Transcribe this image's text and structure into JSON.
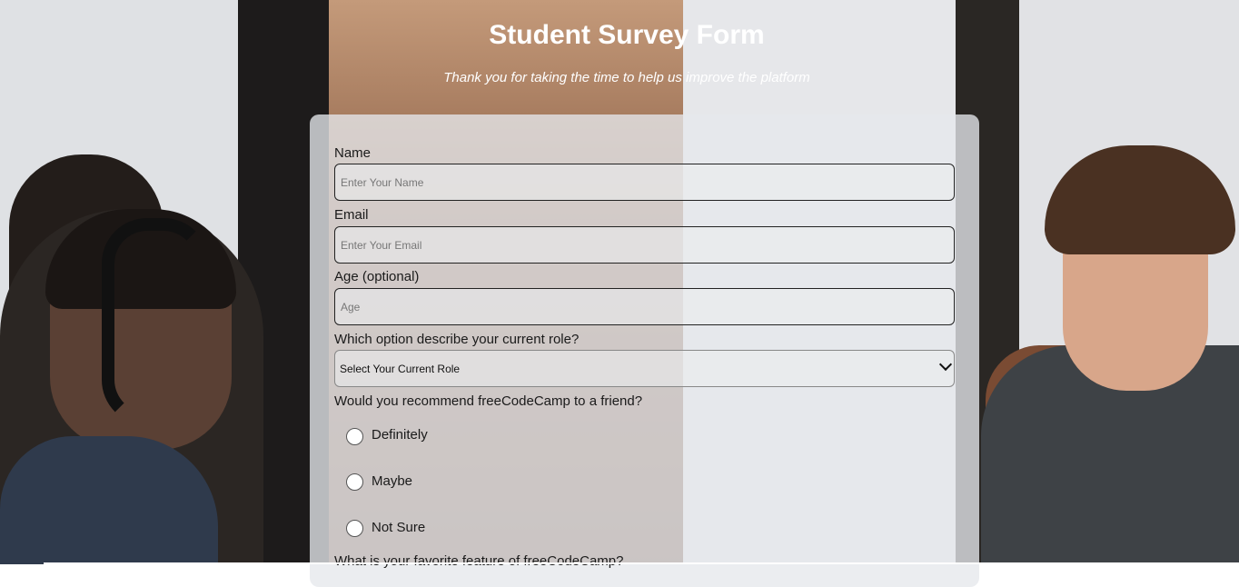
{
  "header": {
    "title": "Student Survey Form",
    "subtitle": "Thank you for taking the time to help us improve the platform"
  },
  "form": {
    "name": {
      "label": "Name",
      "placeholder": "Enter Your Name"
    },
    "email": {
      "label": "Email",
      "placeholder": "Enter Your Email"
    },
    "age": {
      "label": "Age (optional)",
      "placeholder": "Age"
    },
    "role": {
      "label": "Which option describe your current role?",
      "selected": "Select Your Current Role"
    },
    "recommend": {
      "label": "Would you recommend freeCodeCamp to a friend?",
      "options": [
        "Definitely",
        "Maybe",
        "Not Sure"
      ]
    },
    "feature": {
      "label": "What is your favorite feature of freeCodeCamp?"
    }
  }
}
